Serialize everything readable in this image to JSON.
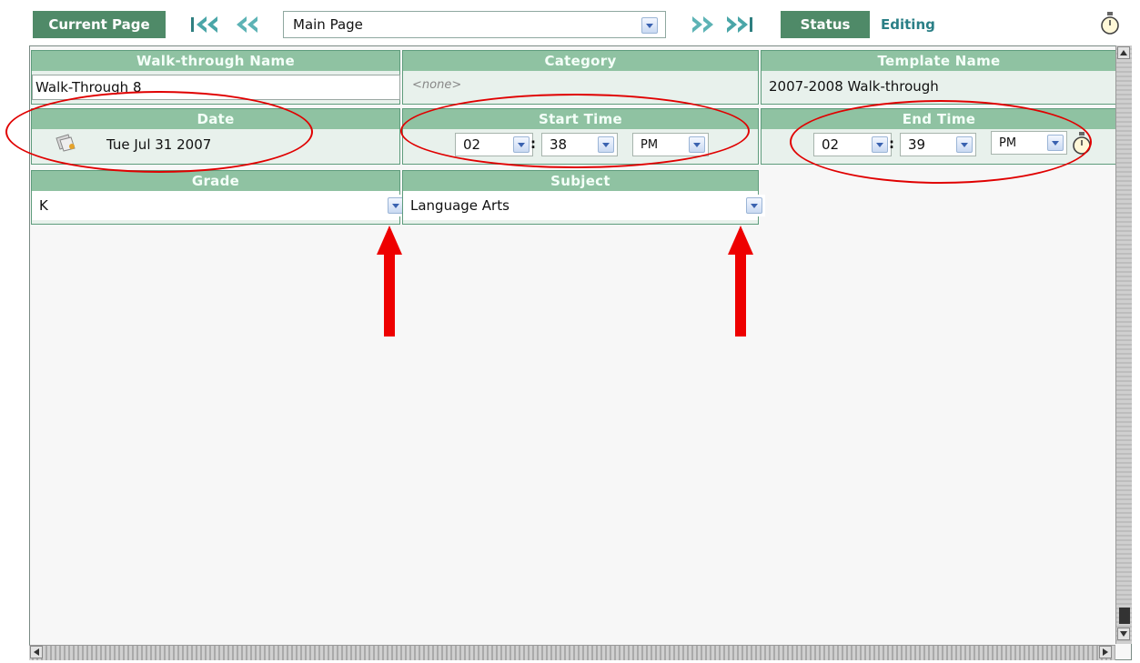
{
  "toolbar": {
    "current_page_label": "Current Page",
    "page_select_value": "Main Page",
    "status_label": "Status",
    "status_value": "Editing"
  },
  "form": {
    "walkthrough_name": {
      "header": "Walk-through Name",
      "value": "Walk-Through 8"
    },
    "category": {
      "header": "Category",
      "value": "<none>"
    },
    "template_name": {
      "header": "Template Name",
      "value": "2007-2008 Walk-through"
    },
    "date": {
      "header": "Date",
      "value": "Tue Jul 31 2007"
    },
    "start_time": {
      "header": "Start Time",
      "hour": "02",
      "minute": "38",
      "ampm": "PM",
      "separator": ":"
    },
    "end_time": {
      "header": "End Time",
      "hour": "02",
      "minute": "39",
      "ampm": "PM",
      "separator": ":"
    },
    "grade": {
      "header": "Grade",
      "value": "K"
    },
    "subject": {
      "header": "Subject",
      "value": "Language Arts"
    }
  },
  "icons": {
    "first": "first-page-icon",
    "prev": "previous-page-icon",
    "next": "next-page-icon",
    "last": "last-page-icon",
    "timer": "stopwatch-icon",
    "calendar": "calendar-icon"
  },
  "colors": {
    "header_green": "#4f8a68",
    "cell_header": "#8fc2a2",
    "status_text": "#2a7f86",
    "annotation_red": "#e00000"
  }
}
